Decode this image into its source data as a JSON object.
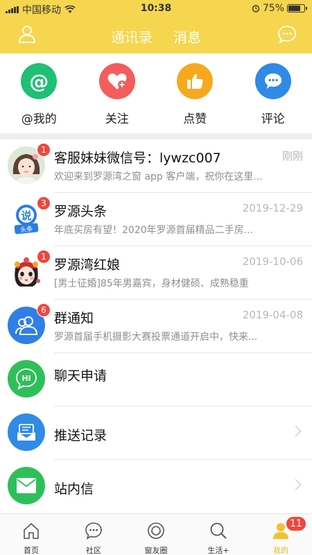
{
  "status_bar": {
    "carrier": "中国移动",
    "time": "10:38",
    "battery_percent": "75%",
    "battery_level": 0.75
  },
  "header": {
    "tabs": [
      {
        "label": "通讯录",
        "active": false
      },
      {
        "label": "消息",
        "active": true
      }
    ],
    "left_icon": "user-icon",
    "right_icon": "chat-bubble-icon"
  },
  "quick_actions": [
    {
      "label": "@我的",
      "icon": "at-icon",
      "color": "#1fbf74"
    },
    {
      "label": "关注",
      "icon": "heart-plus-icon",
      "color": "#f55c5c"
    },
    {
      "label": "点赞",
      "icon": "thumbs-up-icon",
      "color": "#f7a91e"
    },
    {
      "label": "评论",
      "icon": "comment-icon",
      "color": "#2f8be6"
    }
  ],
  "messages": [
    {
      "title": "客服妹妹微信号：lywzc007",
      "time": "刚刚",
      "preview": "欢迎来到罗源湾之窗 app 客户端，祝你在这里...",
      "badge": "1",
      "avatar": "girl-avatar"
    },
    {
      "title": "罗源头条",
      "time": "2019-12-29",
      "preview": "年底买房有望！2020年罗源首届精品二手房...",
      "badge": "3",
      "avatar": "toutiao-logo"
    },
    {
      "title": "罗源湾红娘",
      "time": "2019-10-06",
      "preview": "[男士征婚]85年男嘉宾，身材健硕、成熟稳重",
      "badge": "1",
      "avatar": "matchmaker-avatar"
    },
    {
      "title": "群通知",
      "time": "2019-04-08",
      "preview": "罗源首届手机摄影大赛投票通道开启中，快来...",
      "badge": "6",
      "avatar": "group-icon"
    }
  ],
  "menu_rows": [
    {
      "title": "聊天申请",
      "icon": "hi-icon",
      "color": "#2fbf5a"
    },
    {
      "title": "推送记录",
      "icon": "push-record-icon",
      "color": "#2f8be6"
    },
    {
      "title": "站内信",
      "icon": "mail-icon",
      "color": "#2fbf5a"
    }
  ],
  "bottom_nav": [
    {
      "label": "首页",
      "icon": "home-icon"
    },
    {
      "label": "社区",
      "icon": "community-icon"
    },
    {
      "label": "窗友圈",
      "icon": "circle-icon"
    },
    {
      "label": "生活+",
      "icon": "search-icon"
    },
    {
      "label": "我的",
      "icon": "profile-icon",
      "active": true,
      "badge": "11"
    }
  ],
  "colors": {
    "header_bg": "#f5d64e",
    "badge_red": "#f0473d",
    "accent_yellow": "#e7b92b"
  }
}
